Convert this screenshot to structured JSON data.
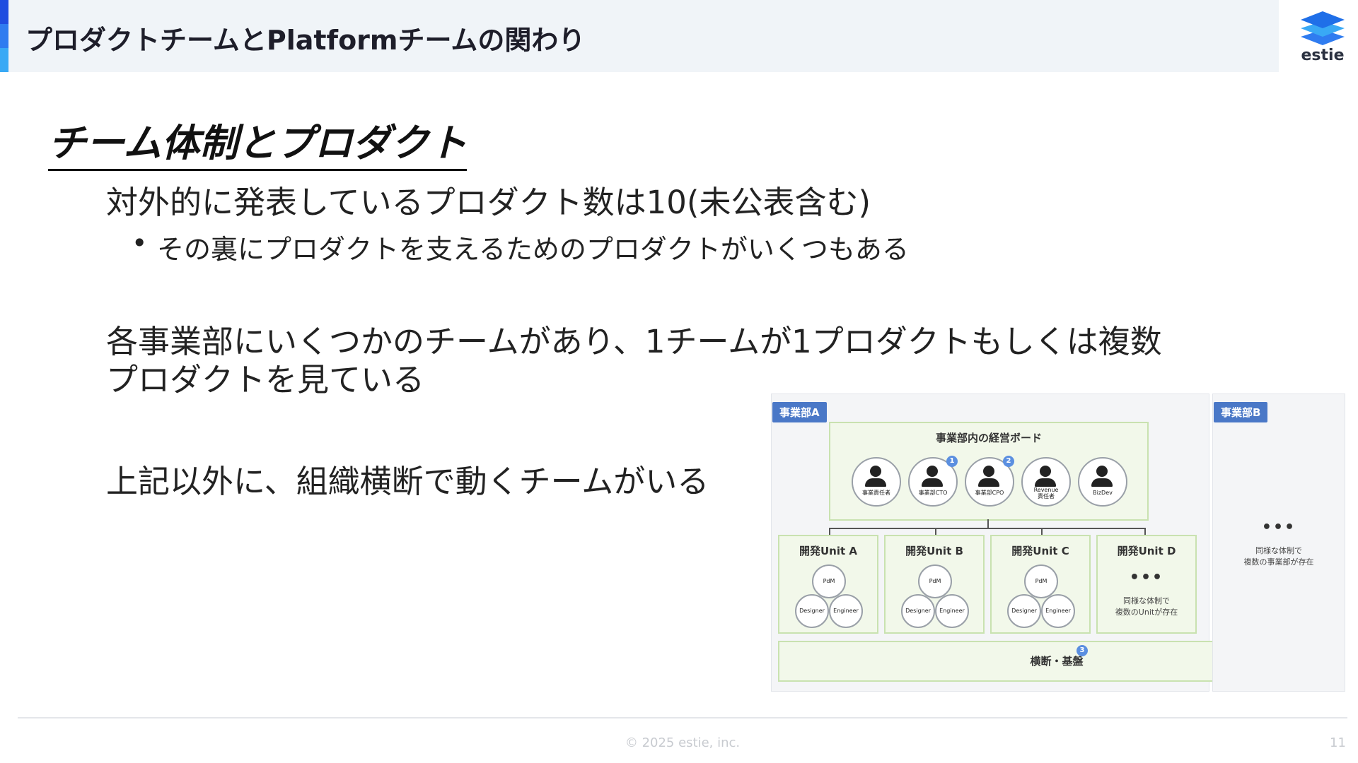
{
  "header": {
    "title": "プロダクトチームとPlatformチームの関わり",
    "logo_text": "estie"
  },
  "colors": {
    "accent_dark": "#1f4de0",
    "accent_mid": "#2f7cf0",
    "accent_light": "#39a9f5",
    "header_bg": "#f0f4f8",
    "diagram_green": "#f2f8ea",
    "tag_blue": "#4a78c7"
  },
  "slide": {
    "section_title": "チーム体制とプロダクト",
    "point1": "対外的に発表しているプロダクト数は10(未公表含む)",
    "point1_bullet_symbol": "•",
    "point1_sub": "その裏にプロダクトを支えるためのプロダクトがいくつもある",
    "point2_line1": "各事業部にいくつかのチームがあり、1チームが1プロダクトもしくは複数",
    "point2_line2": "プロダクトを見ている",
    "point3": "上記以外に、組織横断で動くチームがいる"
  },
  "diagram": {
    "division_a": "事業部A",
    "division_b": "事業部B",
    "board_title": "事業部内の経営ボード",
    "board_members": [
      {
        "label": "事業責任者",
        "badge": ""
      },
      {
        "label": "事業部CTO",
        "badge": "1"
      },
      {
        "label": "事業部CPO",
        "badge": "2"
      },
      {
        "label": "Revenue\n責任者",
        "badge": ""
      },
      {
        "label": "BizDev",
        "badge": ""
      }
    ],
    "units": [
      {
        "title": "開発Unit A",
        "pdm": "PdM",
        "designer": "Designer",
        "engineer": "Engineer"
      },
      {
        "title": "開発Unit B",
        "pdm": "PdM",
        "designer": "Designer",
        "engineer": "Engineer"
      },
      {
        "title": "開発Unit C",
        "pdm": "PdM",
        "designer": "Designer",
        "engineer": "Engineer"
      }
    ],
    "unit_d": {
      "title": "開発Unit D",
      "ellipsis": "•••",
      "note_line1": "同様な体制で",
      "note_line2": "複数のUnitが存在"
    },
    "division_b_ellipsis": "•••",
    "division_b_note_line1": "同様な体制で",
    "division_b_note_line2": "複数の事業部が存在",
    "base_label": "横断・基盤",
    "base_badge": "3"
  },
  "footer": {
    "copyright": "© 2025 estie, inc.",
    "page_number": "11"
  }
}
